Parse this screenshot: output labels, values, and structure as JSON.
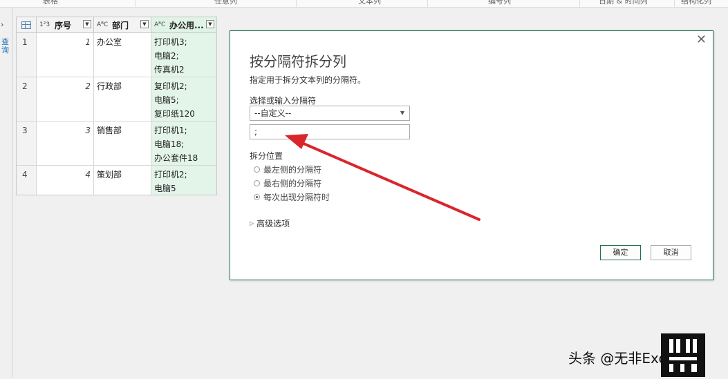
{
  "ribbon": {
    "items": [
      "表格",
      "任意列",
      "文本列",
      "编号列",
      "日期 & 时间列",
      "结构化列"
    ]
  },
  "left_pane": {
    "toggle": "›",
    "text": "查询"
  },
  "grid": {
    "columns": [
      {
        "type": "1²3",
        "title": "序号"
      },
      {
        "type": "AᴮC",
        "title": "部门"
      },
      {
        "type": "AᴮC",
        "title": "办公用..."
      }
    ],
    "rows": [
      {
        "row": "1",
        "seq": "1",
        "dept": "办公室",
        "items": [
          "打印机3;",
          "电脑2;",
          "传真机2"
        ]
      },
      {
        "row": "2",
        "seq": "2",
        "dept": "行政部",
        "items": [
          "复印机2;",
          "电脑5;",
          "复印纸120"
        ]
      },
      {
        "row": "3",
        "seq": "3",
        "dept": "销售部",
        "items": [
          "打印机1;",
          "电脑18;",
          "办公套件18"
        ]
      },
      {
        "row": "4",
        "seq": "4",
        "dept": "策划部",
        "items": [
          "打印机2;",
          "电脑5"
        ]
      }
    ]
  },
  "dialog": {
    "title": "按分隔符拆分列",
    "description": "指定用于拆分文本列的分隔符。",
    "select_label": "选择或输入分隔符",
    "select_value": "--自定义--",
    "delimiter_value": ";",
    "position_label": "拆分位置",
    "options": [
      {
        "label": "最左侧的分隔符",
        "selected": false
      },
      {
        "label": "最右侧的分隔符",
        "selected": false
      },
      {
        "label": "每次出现分隔符时",
        "selected": true
      }
    ],
    "advanced": "高级选项",
    "ok": "确定",
    "cancel": "取消",
    "close": "✕"
  },
  "colors": {
    "accent": "#1e7145",
    "arrow": "#d9262b",
    "highlight_col": "#e3f4e9"
  },
  "watermark": {
    "text": "头条 @无非Excel"
  }
}
